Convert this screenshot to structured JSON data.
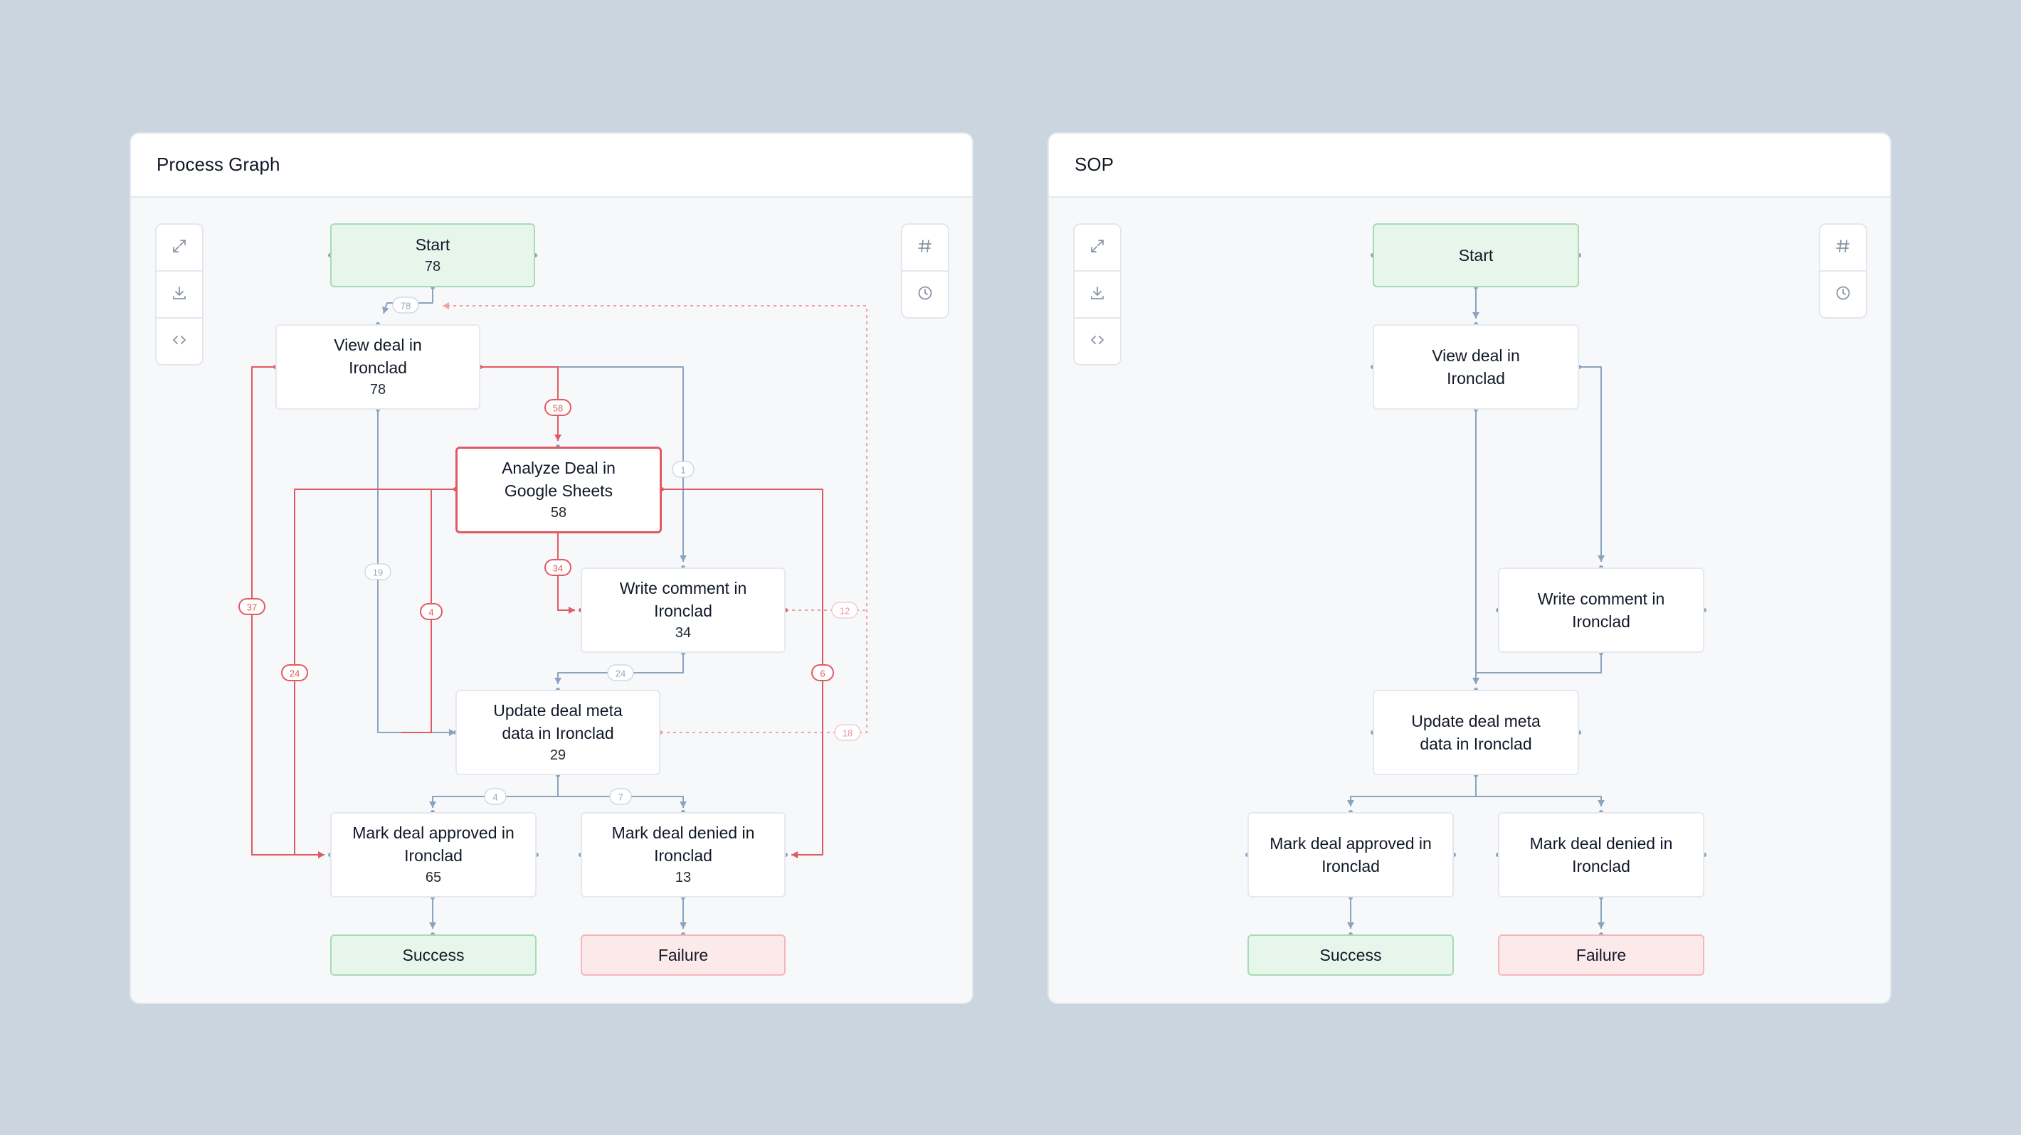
{
  "process_graph": {
    "title": "Process Graph",
    "toolbar_left": [
      {
        "icon": "expand-icon",
        "name": "expand-button"
      },
      {
        "icon": "download-icon",
        "name": "download-button"
      },
      {
        "icon": "code-icon",
        "name": "code-button"
      }
    ],
    "toolbar_right": [
      {
        "icon": "hash-icon",
        "name": "hash-button"
      },
      {
        "icon": "clock-icon",
        "name": "clock-button"
      }
    ],
    "nodes": {
      "start": {
        "label": "Start",
        "count": "78"
      },
      "view": {
        "label": "View deal in\nIronclad",
        "count": "78"
      },
      "analyze": {
        "label": "Analyze Deal in\nGoogle Sheets",
        "count": "58"
      },
      "write": {
        "label": "Write comment in\nIronclad",
        "count": "34"
      },
      "update": {
        "label": "Update deal meta\ndata in Ironclad",
        "count": "29"
      },
      "approved": {
        "label": "Mark deal approved in\nIronclad",
        "count": "65"
      },
      "denied": {
        "label": "Mark deal denied in\nIronclad",
        "count": "13"
      },
      "success": {
        "label": "Success"
      },
      "failure": {
        "label": "Failure"
      }
    },
    "edge_counts": {
      "start_view": "78",
      "update_view_loop": "18",
      "write_view_loop": "12",
      "view_analyze": "58",
      "view_write": "1",
      "view_update": "19",
      "view_approved": "37",
      "analyze_write": "34",
      "analyze_update": "4",
      "analyze_approved": "24",
      "analyze_denied": "6",
      "write_update": "24",
      "update_approved": "4",
      "update_denied": "7"
    }
  },
  "sop": {
    "title": "SOP",
    "toolbar_left": [
      {
        "icon": "expand-icon",
        "name": "expand-button"
      },
      {
        "icon": "download-icon",
        "name": "download-button"
      },
      {
        "icon": "code-icon",
        "name": "code-button"
      }
    ],
    "toolbar_right": [
      {
        "icon": "hash-icon",
        "name": "hash-button"
      },
      {
        "icon": "clock-icon",
        "name": "clock-button"
      }
    ],
    "nodes": {
      "start": {
        "label": "Start"
      },
      "view": {
        "label": "View deal in\nIronclad"
      },
      "write": {
        "label": "Write comment in\nIronclad"
      },
      "update": {
        "label": "Update deal meta\ndata in Ironclad"
      },
      "approved": {
        "label": "Mark deal approved in\nIronclad"
      },
      "denied": {
        "label": "Mark deal denied in\nIronclad"
      },
      "success": {
        "label": "Success"
      },
      "failure": {
        "label": "Failure"
      }
    }
  },
  "colors": {
    "page_bg": "#cbd5e0",
    "edge_normal": "#8aa3bf",
    "edge_highlight": "#e05a63",
    "edge_loop": "#f0a0a6",
    "success_bg": "#e6f6ea",
    "failure_bg": "#fce9ea"
  }
}
